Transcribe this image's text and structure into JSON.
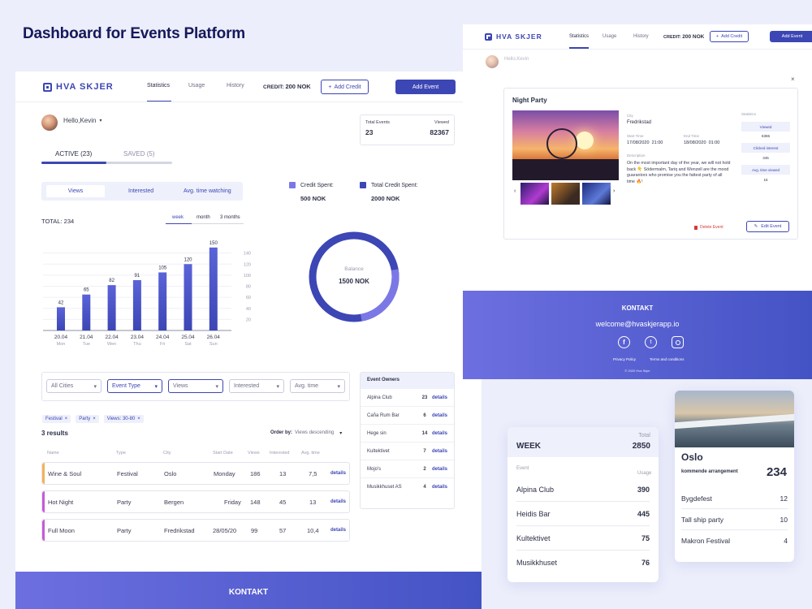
{
  "showcase_title": "Dashboard for Events Platform",
  "app": {
    "logo": "HVA SKJER",
    "nav": [
      "Statistics",
      "Usage",
      "History"
    ],
    "credit_label": "CREDIT:",
    "credit_value": "200 NOK",
    "add_credit": "Add Credit",
    "add_event": "Add Event",
    "greeting": "Hello,Kevin"
  },
  "summary": {
    "total_events_label": "Total Events",
    "total_events": "23",
    "viewed_label": "Viewed",
    "viewed": "82367"
  },
  "tabs": {
    "active": "ACTIVE (23)",
    "saved": "SAVED (5)"
  },
  "toggle": [
    "Views",
    "Interested",
    "Avg. time watching"
  ],
  "credit": {
    "spent_label": "Credit Spent:",
    "spent": "500 NOK",
    "total_label": "Total Credit Spent:",
    "total": "2000 NOK",
    "balance_label": "Balance",
    "balance": "1500 NOK",
    "colors": {
      "spent": "#7b78e6",
      "total": "#3c46b4"
    }
  },
  "chart_total": "TOTAL: 234",
  "periods": [
    "week",
    "month",
    "3 months"
  ],
  "chart_data": {
    "type": "bar",
    "categories": [
      "20.04",
      "21.04",
      "22.04",
      "23.04",
      "24.04",
      "25.04",
      "26.04"
    ],
    "day_labels": [
      "Mon",
      "Tue",
      "Wen",
      "Thu",
      "Fri",
      "Sat",
      "Sun"
    ],
    "values": [
      42,
      65,
      82,
      91,
      105,
      120,
      150
    ],
    "y_ticks": [
      "140",
      "120",
      "100",
      "80",
      "60",
      "40",
      "20"
    ],
    "ylim": [
      0,
      160
    ]
  },
  "filters": [
    "All Cities",
    "Event Type",
    "Views",
    "Interested",
    "Avg. time"
  ],
  "active_tags": [
    "Festival",
    "Party",
    "Views: 30-80"
  ],
  "results_count": "3 results",
  "order_label": "Order by:",
  "order_value": "Views descending",
  "table_headers": [
    "Name",
    "Type",
    "City",
    "Start Date",
    "Views",
    "Interested",
    "Avg. time"
  ],
  "rows": [
    {
      "name": "Wine & Soul",
      "type": "Festival",
      "city": "Oslo",
      "date": "Monday",
      "views": "186",
      "interested": "13",
      "avg": "7,5",
      "link": "details",
      "color": "#f0b35a"
    },
    {
      "name": "Hot Night",
      "type": "Party",
      "city": "Bergen",
      "date": "Friday",
      "views": "148",
      "interested": "45",
      "avg": "13",
      "link": "details",
      "color": "#c65ad6"
    },
    {
      "name": "Full Moon",
      "type": "Party",
      "city": "Fredrikstad",
      "date": "28/05/20",
      "views": "99",
      "interested": "57",
      "avg": "10,4",
      "link": "details",
      "color": "#c65ad6"
    }
  ],
  "owners_title": "Event Owners",
  "owners": [
    {
      "name": "Alpina Club",
      "count": "23",
      "link": "details"
    },
    {
      "name": "Caña Rum Bar",
      "count": "6",
      "link": "details"
    },
    {
      "name": "Hege sin",
      "count": "14",
      "link": "details"
    },
    {
      "name": "Kultektivet",
      "count": "7",
      "link": "details"
    },
    {
      "name": "Mojo's",
      "count": "2",
      "link": "details"
    },
    {
      "name": "Musikkhuset AS",
      "count": "4",
      "link": "details"
    }
  ],
  "footer": {
    "title": "KONTAKT",
    "email": "welcome@hvaskjerapp.io",
    "privacy": "Privacy Policy",
    "terms": "Terms and conditions",
    "copyright": "© 2020 Hva Skjer"
  },
  "modal": {
    "title": "Night Party",
    "city_label": "City",
    "city": "Fredrikstad",
    "start_label": "Start Time",
    "start": "17/08/2020  21:00",
    "end_label": "End Time",
    "end": "18/08/2020  01:00",
    "desc_label": "Description",
    "desc": "On the most important day of the year, we will not hold back 👇 Södermalm, Tariq and Wenzell are the mood guarantors who promise you the fattest party of all time 🔥!",
    "stats_label": "Statistics",
    "viewed_label": "Viewed",
    "viewed": "6365",
    "clicked_label": "Clicked interest",
    "clicked": "345",
    "avg_label": "Avg. time viewed",
    "avg": "15",
    "delete": "Delete Event",
    "edit": "Edit Event"
  },
  "week": {
    "title": "WEEK",
    "total_label": "Total",
    "total": "2850",
    "event_label": "Event",
    "usage_label": "Usage",
    "rows": [
      {
        "name": "Alpina Club",
        "value": "390"
      },
      {
        "name": "Heidis Bar",
        "value": "445"
      },
      {
        "name": "Kultektivet",
        "value": "75"
      },
      {
        "name": "Musikkhuset",
        "value": "76"
      }
    ]
  },
  "city": {
    "name": "Oslo",
    "sub": "kommende arrangement",
    "count": "234",
    "rows": [
      {
        "name": "Bygdefest",
        "value": "12"
      },
      {
        "name": "Tall ship party",
        "value": "10"
      },
      {
        "name": "Makron Festival",
        "value": "4"
      }
    ]
  }
}
